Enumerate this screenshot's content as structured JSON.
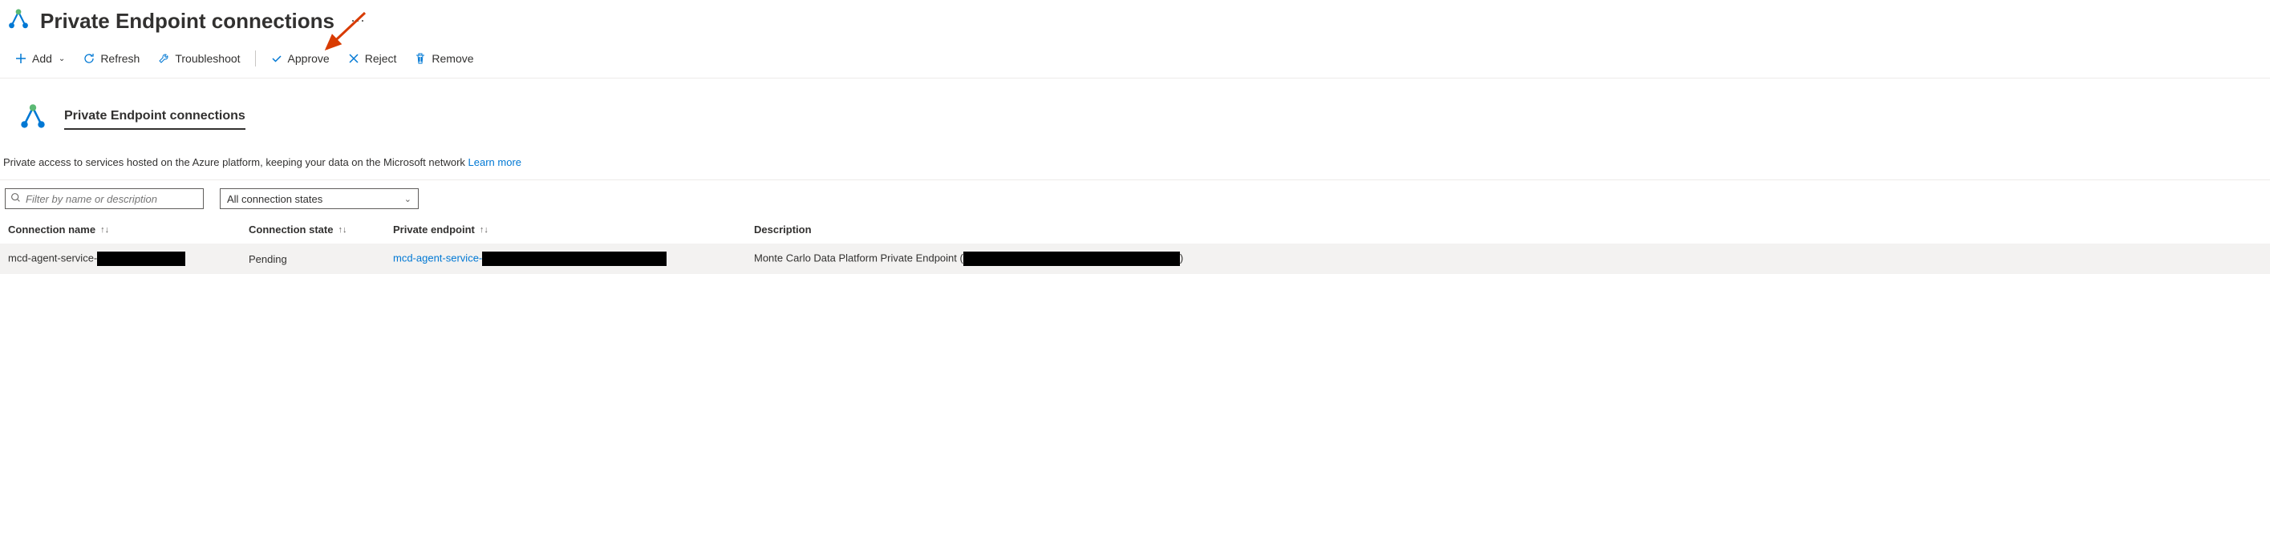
{
  "header": {
    "title": "Private Endpoint connections"
  },
  "toolbar": {
    "add": "Add",
    "refresh": "Refresh",
    "troubleshoot": "Troubleshoot",
    "approve": "Approve",
    "reject": "Reject",
    "remove": "Remove"
  },
  "section": {
    "title": "Private Endpoint connections",
    "description": "Private access to services hosted on the Azure platform, keeping your data on the Microsoft network",
    "learn_more": "Learn more"
  },
  "filters": {
    "search_placeholder": "Filter by name or description",
    "state_dropdown": "All connection states"
  },
  "table": {
    "headers": {
      "name": "Connection name",
      "state": "Connection state",
      "endpoint": "Private endpoint",
      "description": "Description"
    },
    "rows": [
      {
        "name_prefix": "mcd-agent-service-",
        "state": "Pending",
        "endpoint_prefix": "mcd-agent-service-",
        "description_prefix": "Monte Carlo Data Platform Private Endpoint (",
        "description_suffix": ")"
      }
    ]
  }
}
